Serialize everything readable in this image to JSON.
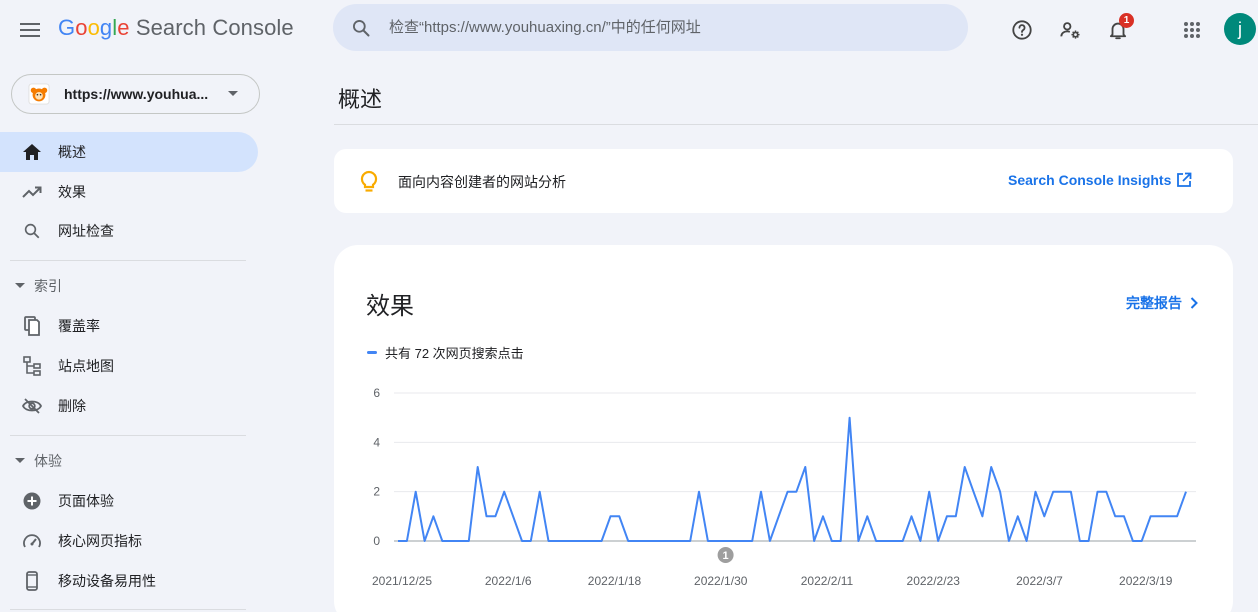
{
  "header": {
    "logo": {
      "letters": [
        {
          "ch": "G",
          "cls": "g-b"
        },
        {
          "ch": "o",
          "cls": "g-r"
        },
        {
          "ch": "o",
          "cls": "g-y"
        },
        {
          "ch": "g",
          "cls": "g-b"
        },
        {
          "ch": "l",
          "cls": "g-g"
        },
        {
          "ch": "e",
          "cls": "g-r"
        }
      ],
      "product": "Search Console"
    },
    "search_placeholder": "检查“https://www.youhuaxing.cn/”中的任何网址",
    "notification_count": "1",
    "avatar_letter": "j"
  },
  "sidebar": {
    "property_url": "https://www.youhua...",
    "items": [
      {
        "label": "概述",
        "icon": "home-icon",
        "active": true
      },
      {
        "label": "效果",
        "icon": "trending-up-icon",
        "active": false
      },
      {
        "label": "网址检查",
        "icon": "search-icon",
        "active": false
      }
    ],
    "section_index": {
      "title": "索引",
      "items": [
        {
          "label": "覆盖率",
          "icon": "file-copy-icon"
        },
        {
          "label": "站点地图",
          "icon": "sitemap-icon"
        },
        {
          "label": "删除",
          "icon": "visibility-off-icon"
        }
      ]
    },
    "section_experience": {
      "title": "体验",
      "items": [
        {
          "label": "页面体验",
          "icon": "plus-circle-icon"
        },
        {
          "label": "核心网页指标",
          "icon": "speed-icon"
        },
        {
          "label": "移动设备易用性",
          "icon": "smartphone-icon"
        }
      ]
    }
  },
  "main": {
    "page_title": "概述",
    "insight": {
      "text": "面向内容创建者的网站分析",
      "link": "Search Console Insights",
      "icon": "lightbulb-icon"
    },
    "performance": {
      "title": "效果",
      "full_report": "完整报告",
      "legend": "共有 72 次网页搜索点击"
    }
  },
  "colors": {
    "accent": "#1a73e8",
    "line": "#4285f4",
    "active_nav": "#d3e3fd",
    "badge": "#d93025",
    "avatar": "#00897b"
  },
  "chart_data": {
    "type": "line",
    "series": [
      {
        "name": "共有 72 次网页搜索点击",
        "values": [
          0,
          0,
          2,
          0,
          1,
          0,
          0,
          0,
          0,
          3,
          1,
          1,
          2,
          1,
          0,
          0,
          2,
          0,
          0,
          0,
          0,
          0,
          0,
          0,
          1,
          1,
          0,
          0,
          0,
          0,
          0,
          0,
          0,
          0,
          2,
          0,
          0,
          0,
          0,
          0,
          0,
          2,
          0,
          1,
          2,
          2,
          3,
          0,
          1,
          0,
          0,
          5,
          0,
          1,
          0,
          0,
          0,
          0,
          1,
          0,
          2,
          0,
          1,
          1,
          3,
          2,
          1,
          3,
          2,
          0,
          1,
          0,
          2,
          1,
          2,
          2,
          2,
          0,
          0,
          2,
          2,
          1,
          1,
          0,
          0,
          1,
          1,
          1,
          1,
          2
        ]
      }
    ],
    "x_tick_labels": [
      "2021/12/25",
      "2022/1/6",
      "2022/1/18",
      "2022/1/30",
      "2022/2/11",
      "2022/2/23",
      "2022/3/7",
      "2022/3/19"
    ],
    "x_tick_indices": [
      0,
      12,
      24,
      36,
      48,
      60,
      72,
      84
    ],
    "y_ticks": [
      0,
      2,
      4,
      6
    ],
    "ylim": [
      0,
      6
    ],
    "annotation": {
      "label": "1",
      "index": 37
    },
    "grid": true
  }
}
